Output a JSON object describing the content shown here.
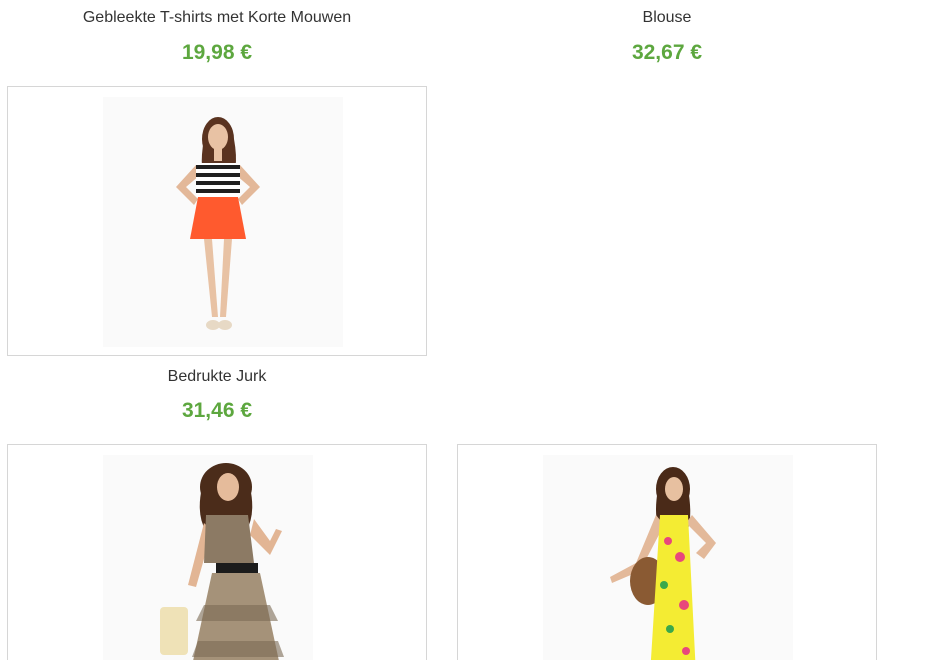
{
  "theme": {
    "price_color": "#5da73f"
  },
  "products": [
    {
      "name": "Gebleekte T-shirts met Korte Mouwen",
      "price": "19,98 €"
    },
    {
      "name": "Blouse",
      "price": "32,67 €"
    },
    {
      "name": "Bedrukte Jurk",
      "price": "31,46 €",
      "image": "model-striped-top-orange-skirt"
    },
    {
      "image": "model-printed-dress-black-belt"
    },
    {
      "image": "model-yellow-floral-maxi-dress"
    }
  ]
}
